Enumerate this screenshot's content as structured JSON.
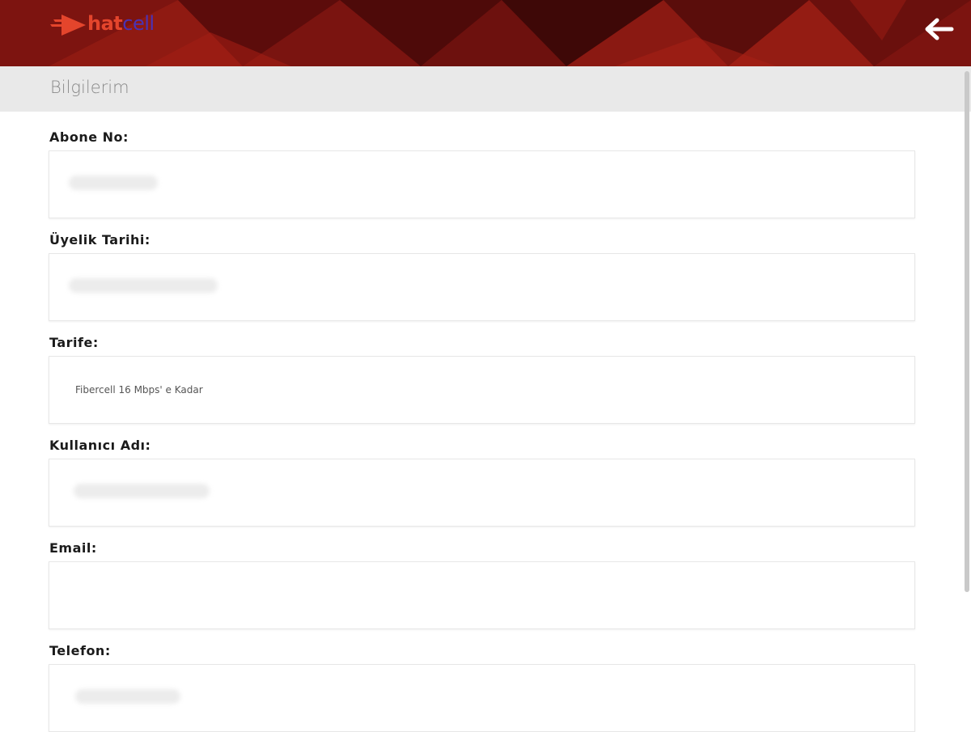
{
  "header": {
    "logo_text_primary": "hat",
    "logo_text_secondary": "cell",
    "back_icon": "arrow-left-icon",
    "colors": {
      "header_dark": "#5a0d0d",
      "header_red": "#9b1812",
      "logo_primary": "#e4452c",
      "logo_secondary": "#4a32b5"
    }
  },
  "page": {
    "title": "Bilgilerim"
  },
  "form": {
    "fields": [
      {
        "label": "Abone No:",
        "value": ""
      },
      {
        "label": "Üyelik Tarihi:",
        "value": ""
      },
      {
        "label": "Tarife:",
        "value": "Fibercell 16 Mbps' e Kadar"
      },
      {
        "label": "Kullanıcı Adı:",
        "value": ""
      },
      {
        "label": "Email:",
        "value": ""
      },
      {
        "label": "Telefon:",
        "value": ""
      }
    ]
  }
}
